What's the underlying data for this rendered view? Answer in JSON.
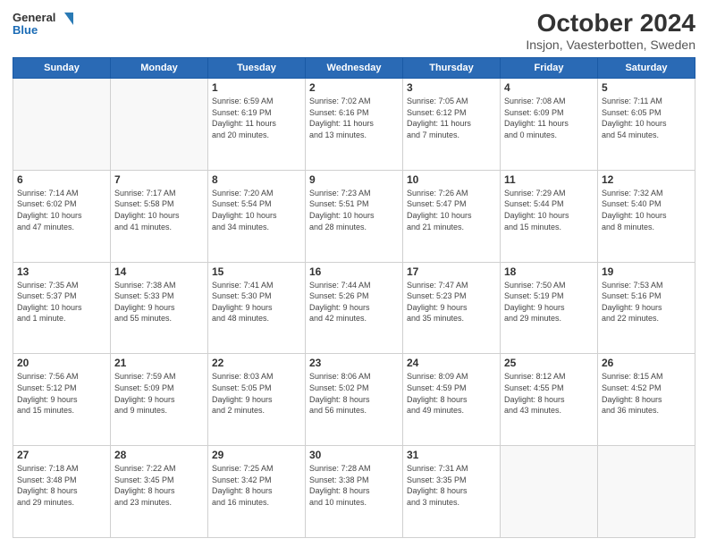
{
  "logo": {
    "line1": "General",
    "line2": "Blue"
  },
  "title": "October 2024",
  "subtitle": "Insjon, Vaesterbotten, Sweden",
  "days_of_week": [
    "Sunday",
    "Monday",
    "Tuesday",
    "Wednesday",
    "Thursday",
    "Friday",
    "Saturday"
  ],
  "weeks": [
    [
      {
        "day": "",
        "info": ""
      },
      {
        "day": "",
        "info": ""
      },
      {
        "day": "1",
        "info": "Sunrise: 6:59 AM\nSunset: 6:19 PM\nDaylight: 11 hours\nand 20 minutes."
      },
      {
        "day": "2",
        "info": "Sunrise: 7:02 AM\nSunset: 6:16 PM\nDaylight: 11 hours\nand 13 minutes."
      },
      {
        "day": "3",
        "info": "Sunrise: 7:05 AM\nSunset: 6:12 PM\nDaylight: 11 hours\nand 7 minutes."
      },
      {
        "day": "4",
        "info": "Sunrise: 7:08 AM\nSunset: 6:09 PM\nDaylight: 11 hours\nand 0 minutes."
      },
      {
        "day": "5",
        "info": "Sunrise: 7:11 AM\nSunset: 6:05 PM\nDaylight: 10 hours\nand 54 minutes."
      }
    ],
    [
      {
        "day": "6",
        "info": "Sunrise: 7:14 AM\nSunset: 6:02 PM\nDaylight: 10 hours\nand 47 minutes."
      },
      {
        "day": "7",
        "info": "Sunrise: 7:17 AM\nSunset: 5:58 PM\nDaylight: 10 hours\nand 41 minutes."
      },
      {
        "day": "8",
        "info": "Sunrise: 7:20 AM\nSunset: 5:54 PM\nDaylight: 10 hours\nand 34 minutes."
      },
      {
        "day": "9",
        "info": "Sunrise: 7:23 AM\nSunset: 5:51 PM\nDaylight: 10 hours\nand 28 minutes."
      },
      {
        "day": "10",
        "info": "Sunrise: 7:26 AM\nSunset: 5:47 PM\nDaylight: 10 hours\nand 21 minutes."
      },
      {
        "day": "11",
        "info": "Sunrise: 7:29 AM\nSunset: 5:44 PM\nDaylight: 10 hours\nand 15 minutes."
      },
      {
        "day": "12",
        "info": "Sunrise: 7:32 AM\nSunset: 5:40 PM\nDaylight: 10 hours\nand 8 minutes."
      }
    ],
    [
      {
        "day": "13",
        "info": "Sunrise: 7:35 AM\nSunset: 5:37 PM\nDaylight: 10 hours\nand 1 minute."
      },
      {
        "day": "14",
        "info": "Sunrise: 7:38 AM\nSunset: 5:33 PM\nDaylight: 9 hours\nand 55 minutes."
      },
      {
        "day": "15",
        "info": "Sunrise: 7:41 AM\nSunset: 5:30 PM\nDaylight: 9 hours\nand 48 minutes."
      },
      {
        "day": "16",
        "info": "Sunrise: 7:44 AM\nSunset: 5:26 PM\nDaylight: 9 hours\nand 42 minutes."
      },
      {
        "day": "17",
        "info": "Sunrise: 7:47 AM\nSunset: 5:23 PM\nDaylight: 9 hours\nand 35 minutes."
      },
      {
        "day": "18",
        "info": "Sunrise: 7:50 AM\nSunset: 5:19 PM\nDaylight: 9 hours\nand 29 minutes."
      },
      {
        "day": "19",
        "info": "Sunrise: 7:53 AM\nSunset: 5:16 PM\nDaylight: 9 hours\nand 22 minutes."
      }
    ],
    [
      {
        "day": "20",
        "info": "Sunrise: 7:56 AM\nSunset: 5:12 PM\nDaylight: 9 hours\nand 15 minutes."
      },
      {
        "day": "21",
        "info": "Sunrise: 7:59 AM\nSunset: 5:09 PM\nDaylight: 9 hours\nand 9 minutes."
      },
      {
        "day": "22",
        "info": "Sunrise: 8:03 AM\nSunset: 5:05 PM\nDaylight: 9 hours\nand 2 minutes."
      },
      {
        "day": "23",
        "info": "Sunrise: 8:06 AM\nSunset: 5:02 PM\nDaylight: 8 hours\nand 56 minutes."
      },
      {
        "day": "24",
        "info": "Sunrise: 8:09 AM\nSunset: 4:59 PM\nDaylight: 8 hours\nand 49 minutes."
      },
      {
        "day": "25",
        "info": "Sunrise: 8:12 AM\nSunset: 4:55 PM\nDaylight: 8 hours\nand 43 minutes."
      },
      {
        "day": "26",
        "info": "Sunrise: 8:15 AM\nSunset: 4:52 PM\nDaylight: 8 hours\nand 36 minutes."
      }
    ],
    [
      {
        "day": "27",
        "info": "Sunrise: 7:18 AM\nSunset: 3:48 PM\nDaylight: 8 hours\nand 29 minutes."
      },
      {
        "day": "28",
        "info": "Sunrise: 7:22 AM\nSunset: 3:45 PM\nDaylight: 8 hours\nand 23 minutes."
      },
      {
        "day": "29",
        "info": "Sunrise: 7:25 AM\nSunset: 3:42 PM\nDaylight: 8 hours\nand 16 minutes."
      },
      {
        "day": "30",
        "info": "Sunrise: 7:28 AM\nSunset: 3:38 PM\nDaylight: 8 hours\nand 10 minutes."
      },
      {
        "day": "31",
        "info": "Sunrise: 7:31 AM\nSunset: 3:35 PM\nDaylight: 8 hours\nand 3 minutes."
      },
      {
        "day": "",
        "info": ""
      },
      {
        "day": "",
        "info": ""
      }
    ]
  ]
}
